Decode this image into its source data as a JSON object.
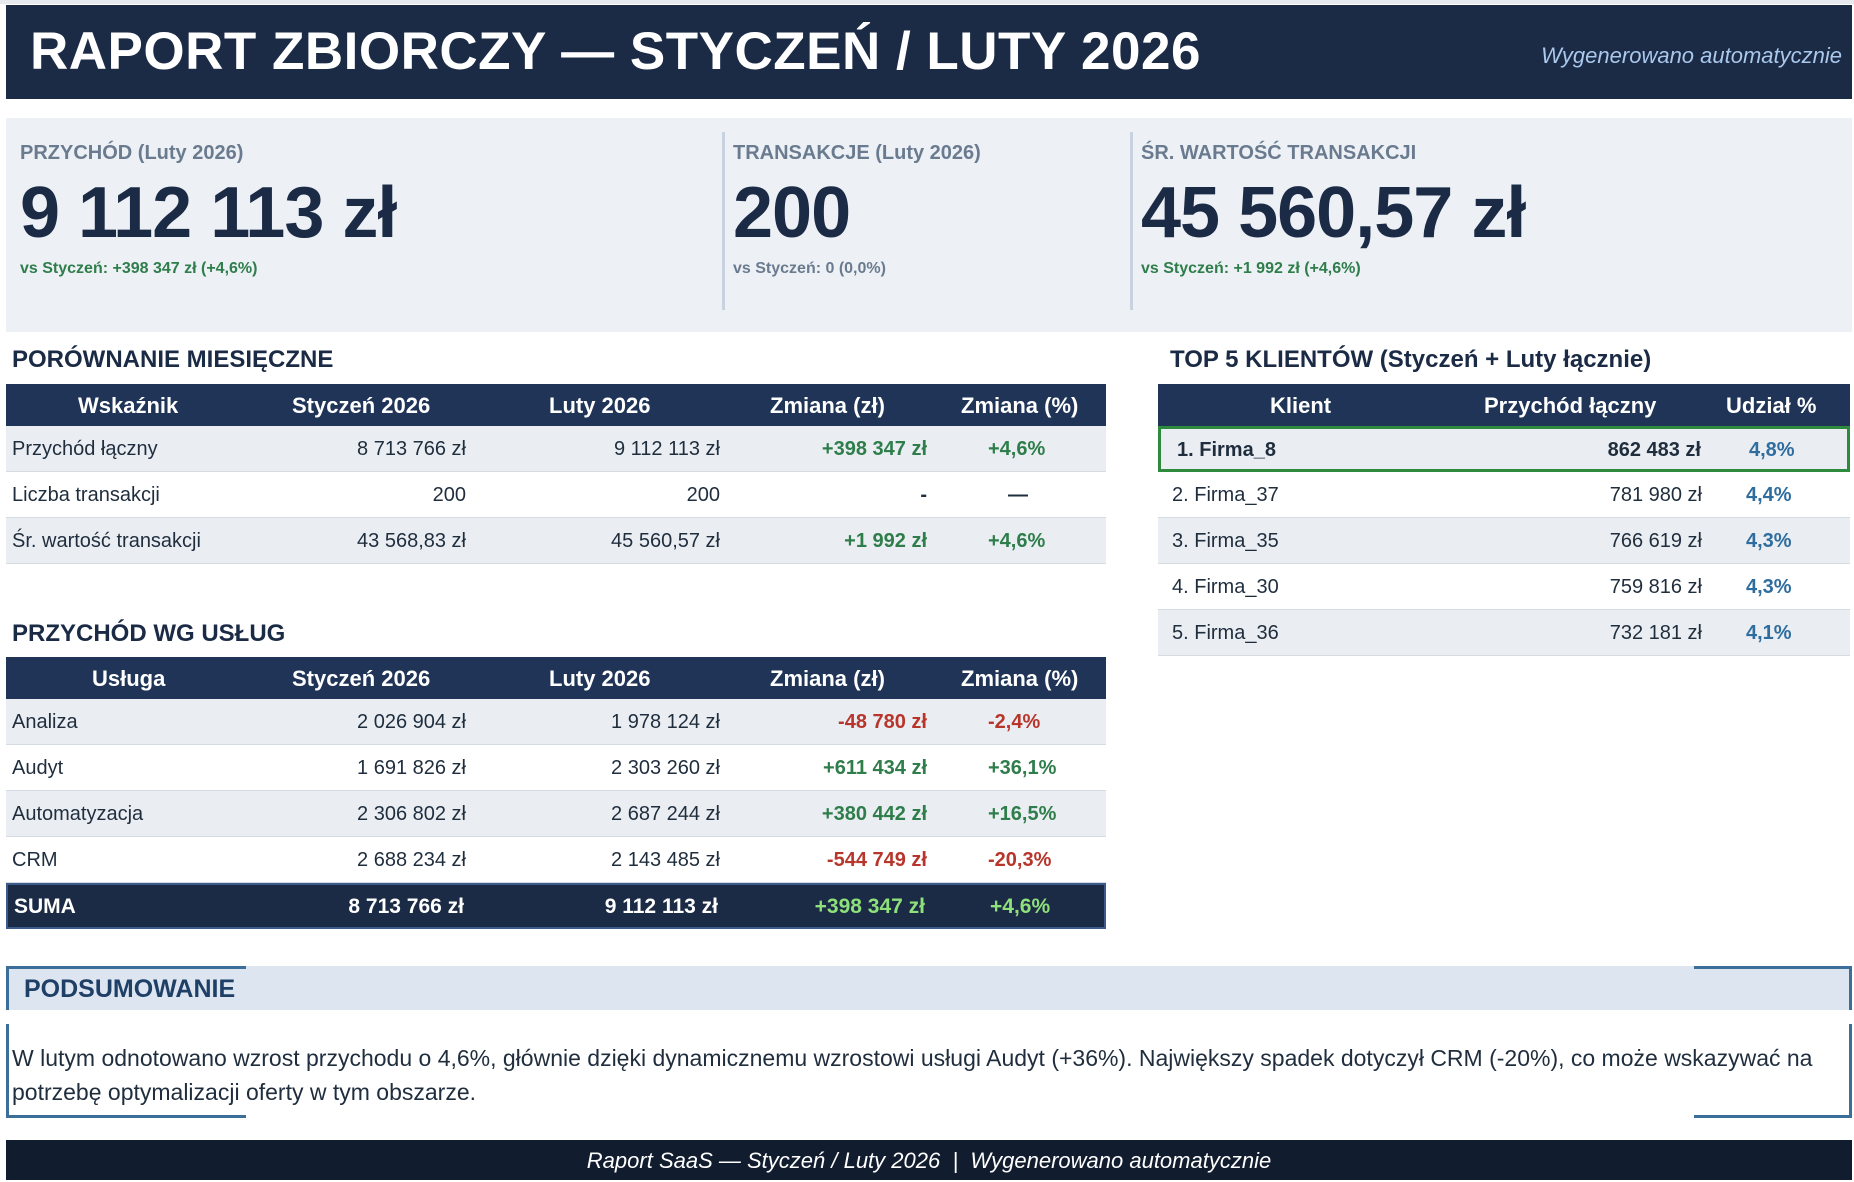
{
  "header": {
    "title": "RAPORT ZBIORCZY — STYCZEŃ / LUTY 2026",
    "generated": "Wygenerowano automatycznie"
  },
  "kpis": [
    {
      "label": "PRZYCHÓD (Luty 2026)",
      "value": "9 112 113 zł",
      "compare": "vs Styczeń: +398 347 zł (+4,6%)",
      "trend": "positive"
    },
    {
      "label": "TRANSAKCJE (Luty 2026)",
      "value": "200",
      "compare": "vs Styczeń: 0 (0,0%)",
      "trend": "neutral"
    },
    {
      "label": "ŚR. WARTOŚĆ TRANSAKCJI",
      "value": "45 560,57 zł",
      "compare": "vs Styczeń: +1 992 zł (+4,6%)",
      "trend": "positive"
    }
  ],
  "monthly": {
    "title": "PORÓWNANIE MIESIĘCZNE",
    "headers": [
      "Wskaźnik",
      "Styczeń 2026",
      "Luty 2026",
      "Zmiana (zł)",
      "Zmiana (%)"
    ],
    "rows": [
      [
        "Przychód łączny",
        "8 713 766 zł",
        "9 112 113 zł",
        "+398 347 zł",
        "+4,6%"
      ],
      [
        "Liczba transakcji",
        "200",
        "200",
        "-",
        "—"
      ],
      [
        "Śr. wartość transakcji",
        "43 568,83 zł",
        "45 560,57 zł",
        "+1 992 zł",
        "+4,6%"
      ]
    ]
  },
  "services": {
    "title": "PRZYCHÓD WG USŁUG",
    "headers": [
      "Usługa",
      "Styczeń 2026",
      "Luty 2026",
      "Zmiana (zł)",
      "Zmiana (%)"
    ],
    "rows": [
      [
        "Analiza",
        "2 026 904 zł",
        "1 978 124 zł",
        "-48 780 zł",
        "-2,4%"
      ],
      [
        "Audyt",
        "1 691 826 zł",
        "2 303 260 zł",
        "+611 434 zł",
        "+36,1%"
      ],
      [
        "Automatyzacja",
        "2 306 802 zł",
        "2 687 244 zł",
        "+380 442 zł",
        "+16,5%"
      ],
      [
        "CRM",
        "2 688 234 zł",
        "2 143 485 zł",
        "-544 749 zł",
        "-20,3%"
      ]
    ],
    "total": [
      "SUMA",
      "8 713 766 zł",
      "9 112 113 zł",
      "+398 347 zł",
      "+4,6%"
    ]
  },
  "top5": {
    "title": "TOP 5 KLIENTÓW  (Styczeń + Luty łącznie)",
    "headers": [
      "Klient",
      "Przychód łączny",
      "Udział %"
    ],
    "rows": [
      [
        "1. Firma_8",
        "862 483 zł",
        "4,8%"
      ],
      [
        "2. Firma_37",
        "781 980 zł",
        "4,4%"
      ],
      [
        "3. Firma_35",
        "766 619 zł",
        "4,3%"
      ],
      [
        "4. Firma_30",
        "759 816 zł",
        "4,3%"
      ],
      [
        "5. Firma_36",
        "732 181 zł",
        "4,1%"
      ]
    ]
  },
  "summary": {
    "title": "PODSUMOWANIE",
    "text": "W lutym odnotowano wzrost przychodu o 4,6%, głównie dzięki dynamicznemu wzrostowi usługi Audyt (+36%). Największy spadek dotyczył CRM (-20%), co może wskazywać na potrzebę optymalizacji oferty w tym obszarze."
  },
  "footer": {
    "text": "Raport SaaS — Styczeń / Luty 2026  |  Wygenerowano automatycznie"
  },
  "colors": {
    "header_bg": "#1b2a45",
    "table_head_bg": "#1f3457",
    "positive": "#2e7d4a",
    "negative": "#b8352b",
    "highlight_border": "#2e8b3e",
    "share_text": "#2f6d9e"
  }
}
